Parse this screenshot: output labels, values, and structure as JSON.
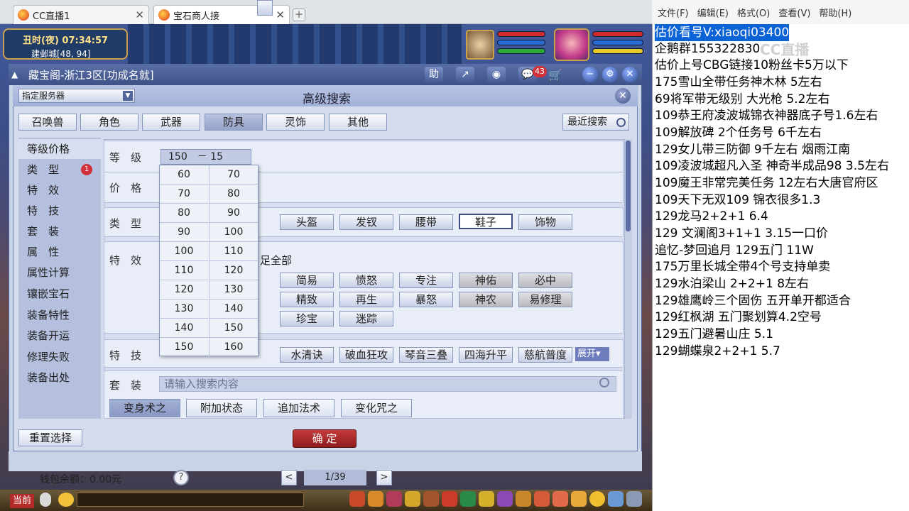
{
  "browser": {
    "tabs": [
      {
        "label": "CC直播1",
        "close": "✕"
      },
      {
        "label": "宝石商人接",
        "close": "✕"
      }
    ],
    "new_tab": "+"
  },
  "hud": {
    "time": "丑时(夜) 07:34:57",
    "location": "建邺城[48, 94]"
  },
  "window": {
    "title": "藏宝阁-浙江3区[功成名就]",
    "buttons": {
      "assist": "助",
      "share": "↗",
      "record": "◉",
      "mail_badge": "43",
      "cart": "🛒",
      "minimize": "−",
      "settings": "⚙",
      "close": "✕"
    }
  },
  "dialog": {
    "title": "高级搜索",
    "server_select": "指定服务器",
    "close": "✕",
    "categories": [
      "召唤兽",
      "角色",
      "武器",
      "防具",
      "灵饰",
      "其他"
    ],
    "selected_category": "防具",
    "recent_search": "最近搜索",
    "side_nav": [
      {
        "label": "等级价格"
      },
      {
        "label": "类　型",
        "badge": "1"
      },
      {
        "label": "特　效"
      },
      {
        "label": "特　技"
      },
      {
        "label": "套　装"
      },
      {
        "label": "属　性"
      },
      {
        "label": "属性计算"
      },
      {
        "label": "镶嵌宝石"
      },
      {
        "label": "装备特性"
      },
      {
        "label": "装备开运"
      },
      {
        "label": "修理失败"
      },
      {
        "label": "装备出处"
      }
    ],
    "level": {
      "label": "等　级",
      "value": "150　－ 15"
    },
    "price": {
      "label": "价　格"
    },
    "type": {
      "label": "类　型",
      "options": [
        "头盔",
        "发钗",
        "腰带",
        "鞋子",
        "饰物"
      ],
      "selected": "鞋子"
    },
    "effect": {
      "label": "特　效",
      "satisfy_all": "足全部",
      "row1": [
        "简易",
        "愤怒",
        "专注",
        "神佑",
        "必中"
      ],
      "row2": [
        "精致",
        "再生",
        "暴怒",
        "神农",
        "易修理"
      ],
      "row3": [
        "珍宝",
        "迷踪"
      ]
    },
    "skill": {
      "label": "特　技",
      "options": [
        "水清诀",
        "破血狂攻",
        "琴音三叠",
        "四海升平",
        "慈航普度"
      ],
      "expand": "展开▾"
    },
    "suit": {
      "label": "套　装",
      "placeholder": "请输入搜索内容",
      "tabs": [
        "变身术之",
        "附加状态",
        "追加法术",
        "变化咒之"
      ]
    },
    "level_dropdown": {
      "left": [
        "60",
        "70",
        "80",
        "90",
        "100",
        "110",
        "120",
        "130",
        "140",
        "150"
      ],
      "right": [
        "70",
        "80",
        "90",
        "100",
        "110",
        "120",
        "130",
        "140",
        "150",
        "160"
      ]
    },
    "reset": "重置选择",
    "confirm": "确 定"
  },
  "footer": {
    "wallet": "钱包余额：0.00元",
    "help": "?",
    "prev": "<",
    "next": ">",
    "page": "1/39"
  },
  "gamebar": {
    "now": "当前"
  },
  "notepad": {
    "menu": [
      "文件(F)",
      "编辑(E)",
      "格式(O)",
      "查看(V)",
      "帮助(H)"
    ],
    "lines": [
      "估价看号V:xiaoqi03400",
      "企鹅群155322830",
      "估价上号CBG链接10粉丝卡5万以下",
      "175雪山全带任务神木林 5左右",
      "69将军带无级别 大光枪 5.2左右",
      "109恭王府凌波城锦衣神器底子号1.6左右",
      "109解放碑 2个任务号 6千左右",
      "129女儿带三防御 9千左右 烟雨江南",
      "109凌波城超凡入圣 神奇半成品98 3.5左右",
      "109魔王非常完美任务 12左右大唐官府区",
      "109天下无双109  锦衣很多1.3",
      "129龙马2+2+1  6.4",
      "129 文澜阁3+1+1   3.15一口价",
      "追忆-梦回追月 129五门 11W",
      "175万里长城全带4个号支持单卖",
      "129水泊梁山 2+2+1 8左右",
      "129雄鹰岭三个固伤 五开单开都适合",
      "129红枫湖 五门聚划算4.2空号",
      "129五门避暑山庄  5.1",
      "129蝴蝶泉2+2+1  5.7"
    ],
    "watermark": "CC直播"
  }
}
